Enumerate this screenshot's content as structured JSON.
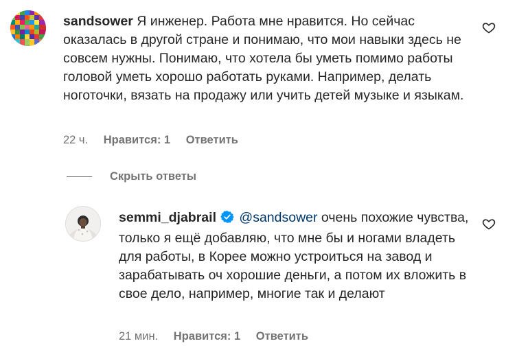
{
  "comments": [
    {
      "username": "sandsower",
      "text": "Я инженер. Работа мне нравится. Но сейчас оказалась в другой стране и понимаю, что мои навыки здесь не совсем нужны. Понимаю, что хотела бы уметь помимо работы головой уметь хорошо работать руками. Например, делать ноготочки, вязать на продажу или учить детей музыке и языкам.",
      "time": "22 ч.",
      "likes": "Нравится: 1",
      "reply": "Ответить",
      "avatar_icon": "colorful-mosaic-avatar",
      "like_icon": "heart-outline-icon"
    }
  ],
  "replies_toggle": {
    "label": "Скрыть ответы"
  },
  "replies": [
    {
      "username": "semmi_djabrail",
      "verified": true,
      "mention": "@sandsower",
      "text": " очень похожие чувства, только я ещё добавляю, что мне бы и ногами владеть для работы, в Корее можно устроиться на завод и зарабатывать оч хорошие деньги, а потом их вложить в свое дело, например, многие так и делают",
      "time": "21 мин.",
      "likes": "Нравится: 1",
      "reply": "Ответить",
      "avatar_icon": "person-photo-avatar",
      "like_icon": "heart-outline-icon"
    }
  ],
  "colors": {
    "text": "#262626",
    "secondary": "#737373",
    "mention": "#00376b",
    "verified": "#0095f6"
  }
}
